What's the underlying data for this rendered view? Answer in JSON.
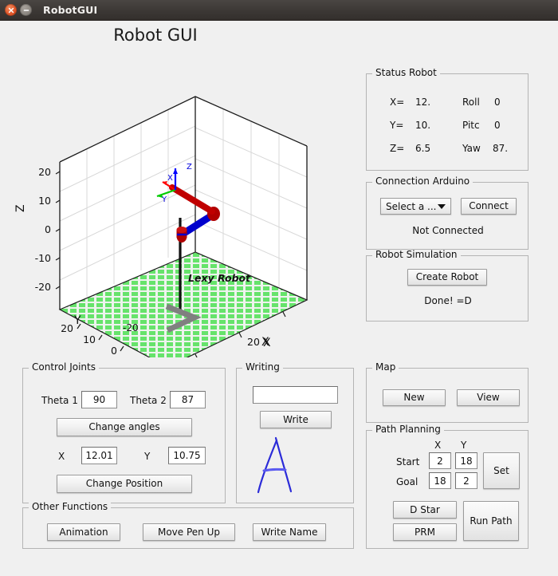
{
  "window": {
    "title": "RobotGUI",
    "close_icon": "close-icon",
    "minimize_icon": "minimize-icon"
  },
  "app_title": "Robot GUI",
  "plot": {
    "robot_label": "Lexy Robot",
    "axis_x_label": "X",
    "axis_y_label": "Y",
    "axis_z_label": "Z",
    "x_ticks": [
      "-20",
      "0",
      "20"
    ],
    "y_ticks": [
      "20",
      "10",
      "0",
      "-10",
      "-20"
    ],
    "z_ticks": [
      "20",
      "10",
      "0",
      "-10",
      "-20"
    ],
    "frame_x_label": "X",
    "frame_y_label": "Y",
    "frame_z_label": "Z",
    "colors": {
      "floor": "#5ee05e",
      "link_upper": "#c00000",
      "link_lower": "#0000c8",
      "axis_x": "#ff0000",
      "axis_y": "#00d000",
      "axis_z": "#0000ff",
      "pen_trace": "#808080"
    }
  },
  "status_robot": {
    "legend": "Status Robot",
    "rows": [
      {
        "label": "X=",
        "value": "12.",
        "label2": "Roll",
        "value2": "0"
      },
      {
        "label": "Y=",
        "value": "10.",
        "label2": "Pitc",
        "value2": "0"
      },
      {
        "label": "Z=",
        "value": "6.5",
        "label2": "Yaw",
        "value2": "87."
      }
    ]
  },
  "connection_arduino": {
    "legend": "Connection Arduino",
    "port_select": "Select a ...",
    "connect_button": "Connect",
    "status": "Not Connected"
  },
  "robot_simulation": {
    "legend": "Robot Simulation",
    "create_button": "Create Robot",
    "status": "Done! =D"
  },
  "control_joints": {
    "legend": "Control Joints",
    "theta1_label": "Theta 1",
    "theta1_value": "90",
    "theta2_label": "Theta 2",
    "theta2_value": "87",
    "change_angles_button": "Change angles",
    "x_label": "X",
    "x_value": "12.01",
    "y_label": "Y",
    "y_value": "10.75",
    "change_position_button": "Change Position"
  },
  "writing": {
    "legend": "Writing",
    "input_value": "",
    "input_placeholder": "",
    "write_button": "Write",
    "preview_letter": "A"
  },
  "other_functions": {
    "legend": "Other Functions",
    "animation_button": "Animation",
    "move_pen_up_button": "Move Pen Up",
    "write_name_button": "Write Name"
  },
  "map": {
    "legend": "Map",
    "new_button": "New",
    "view_button": "View"
  },
  "path_planning": {
    "legend": "Path Planning",
    "col_x": "X",
    "col_y": "Y",
    "start_label": "Start",
    "start_x": "2",
    "start_y": "18",
    "goal_label": "Goal",
    "goal_x": "18",
    "goal_y": "2",
    "set_button": "Set",
    "dstar_button": "D Star",
    "prm_button": "PRM",
    "run_path_button": "Run Path"
  }
}
